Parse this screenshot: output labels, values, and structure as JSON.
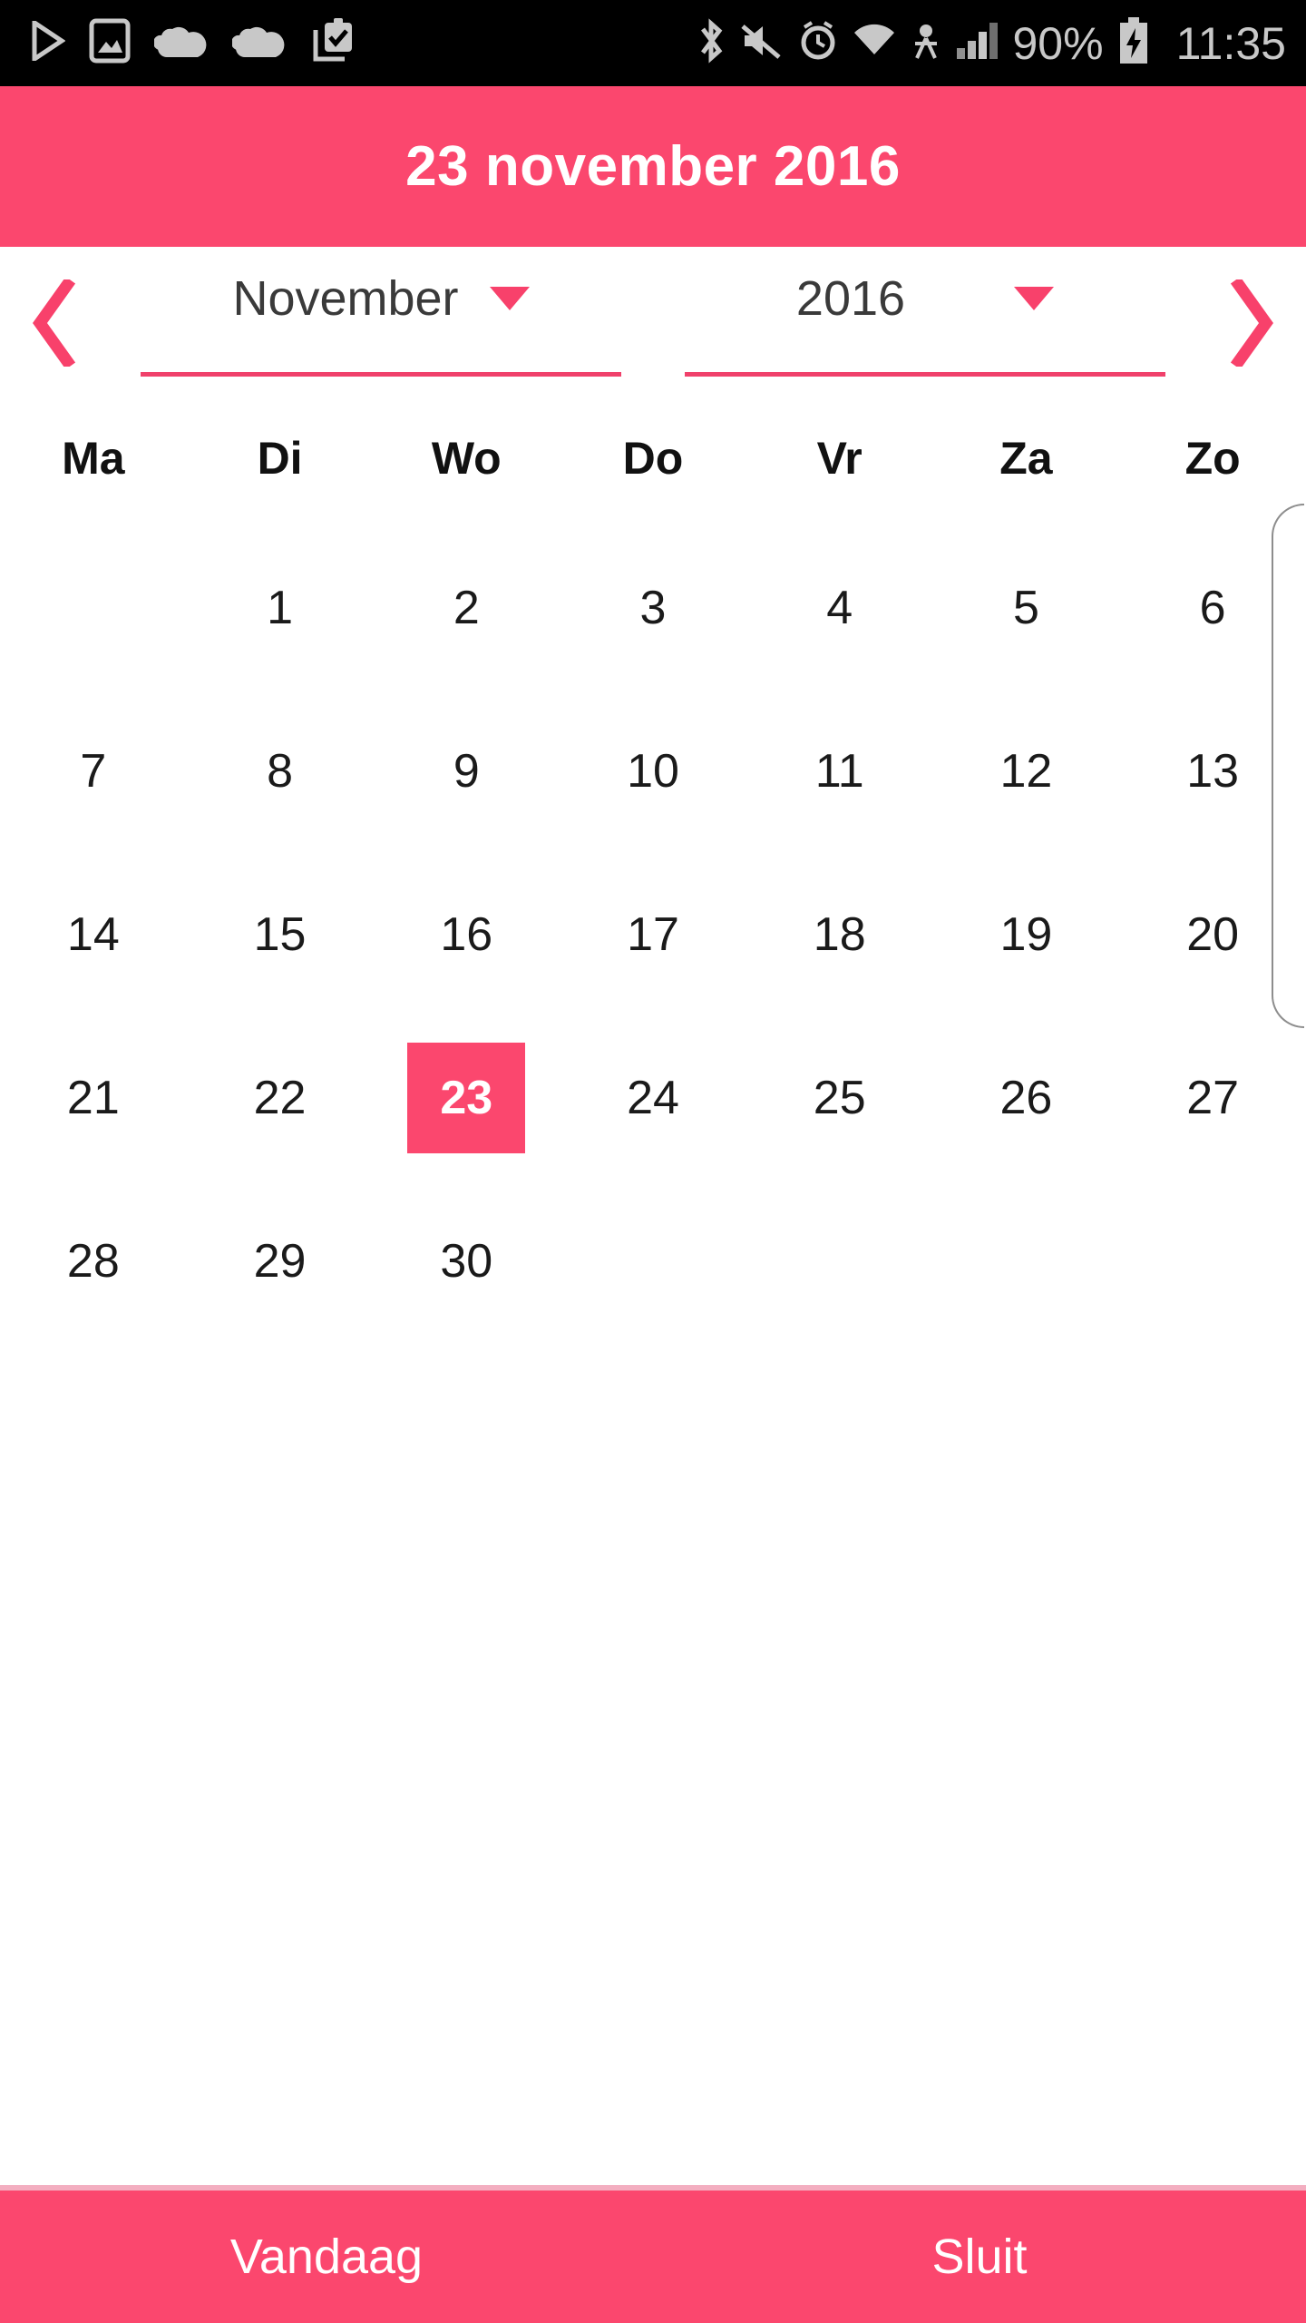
{
  "status_bar": {
    "left_icons": [
      {
        "name": "play-icon",
        "glyph": "play"
      },
      {
        "name": "photo-icon",
        "glyph": "photo"
      },
      {
        "name": "cloud-icon-1",
        "glyph": "cloud"
      },
      {
        "name": "cloud-icon-2",
        "glyph": "cloud"
      },
      {
        "name": "clipboard-check-icon",
        "glyph": "clipboard"
      }
    ],
    "right_icons": [
      {
        "name": "bluetooth-icon",
        "glyph": "bluetooth"
      },
      {
        "name": "mute-icon",
        "glyph": "mute"
      },
      {
        "name": "alarm-icon",
        "glyph": "alarm"
      },
      {
        "name": "wifi-icon",
        "glyph": "wifi"
      },
      {
        "name": "location-icon",
        "glyph": "location"
      },
      {
        "name": "signal-icon",
        "glyph": "signal"
      }
    ],
    "battery_percent": "90%",
    "battery_icon": "battery-charging-icon",
    "time": "11:35"
  },
  "header": {
    "title": "23 november 2016"
  },
  "selector": {
    "prev_label": "chevron-left-icon",
    "next_label": "chevron-right-icon",
    "month": "November",
    "year": "2016"
  },
  "weekdays": [
    "Ma",
    "Di",
    "Wo",
    "Do",
    "Vr",
    "Za",
    "Zo"
  ],
  "calendar": {
    "month": "November",
    "year": "2016",
    "first_weekday_index": 1,
    "days_in_month": 30,
    "selected_day": 23,
    "cells": [
      "",
      "1",
      "2",
      "3",
      "4",
      "5",
      "6",
      "7",
      "8",
      "9",
      "10",
      "11",
      "12",
      "13",
      "14",
      "15",
      "16",
      "17",
      "18",
      "19",
      "20",
      "21",
      "22",
      "23",
      "24",
      "25",
      "26",
      "27",
      "28",
      "29",
      "30",
      "",
      "",
      "",
      ""
    ]
  },
  "bottom_bar": {
    "today_label": "Vandaag",
    "close_label": "Sluit"
  },
  "colors": {
    "accent_pink": "#FB476E",
    "status_bar_bg": "#000000",
    "status_text": "#C8C8C8",
    "day_text": "#1A1A1A",
    "divider": "#F3AEC0"
  }
}
